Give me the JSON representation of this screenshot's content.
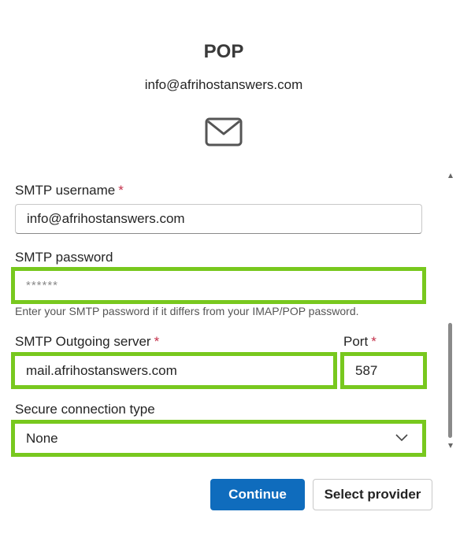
{
  "header": {
    "title": "POP",
    "email": "info@afrihostanswers.com",
    "icon": "envelope-icon"
  },
  "form": {
    "smtp_username": {
      "label": "SMTP username",
      "required": "*",
      "value": "info@afrihostanswers.com"
    },
    "smtp_password": {
      "label": "SMTP password",
      "value": "******",
      "hint": "Enter your SMTP password if it differs from your IMAP/POP password."
    },
    "smtp_server": {
      "label": "SMTP Outgoing server",
      "required": "*",
      "value": "mail.afrihostanswers.com"
    },
    "port": {
      "label": "Port",
      "required": "*",
      "value": "587"
    },
    "secure_connection": {
      "label": "Secure connection type",
      "value": "None"
    }
  },
  "buttons": {
    "continue": "Continue",
    "select_provider": "Select provider"
  },
  "colors": {
    "accent": "#0f6cbd",
    "highlight": "#78c81e",
    "required": "#c4314b"
  }
}
